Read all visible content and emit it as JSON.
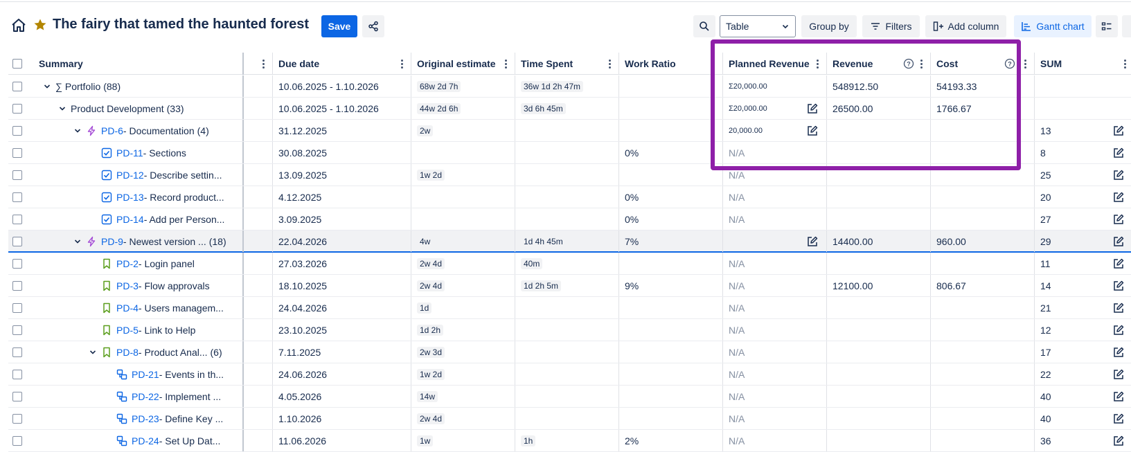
{
  "toolbar": {
    "title": "The fairy that tamed the haunted forest",
    "save_label": "Save",
    "view_select_value": "Table",
    "group_by_label": "Group by",
    "filters_label": "Filters",
    "add_column_label": "Add column",
    "gantt_label": "Gantt chart"
  },
  "columns": {
    "summary": "Summary",
    "due_date": "Due date",
    "original_estimate": "Original estimate",
    "time_spent": "Time Spent",
    "work_ratio": "Work Ratio",
    "planned_revenue": "Planned Revenue",
    "revenue": "Revenue",
    "cost": "Cost",
    "sum": "SUM"
  },
  "colors": {
    "accent": "#0c66e4",
    "highlight": "#8e1fa8",
    "epic": "#a54cd6",
    "task": "#0c66e4",
    "story": "#5b9e1d",
    "subtask": "#0c66e4"
  },
  "rows": [
    {
      "indent": 0,
      "chevron": true,
      "type": "sum",
      "key": "",
      "title": "∑ Portfolio",
      "count": "(88)",
      "due": "10.06.2025 - 1.10.2026",
      "estimate": "68w 2d 7h",
      "spent": "36w 1d 2h 47m",
      "ratio": "",
      "planned": "Σ20,000.00",
      "planned_edit": false,
      "revenue": "548912.50",
      "cost": "54193.33",
      "sum": "",
      "sum_edit": false
    },
    {
      "indent": 1,
      "chevron": true,
      "type": "none",
      "key": "",
      "title": "Product Development",
      "count": "(33)",
      "due": "10.06.2025 - 1.10.2026",
      "estimate": "44w 2d 6h",
      "spent": "3d 6h 45m",
      "ratio": "",
      "planned": "Σ20,000.00",
      "planned_edit": true,
      "revenue": "26500.00",
      "cost": "1766.67",
      "sum": "",
      "sum_edit": false
    },
    {
      "indent": 2,
      "chevron": true,
      "type": "epic",
      "key": "PD-6",
      "title": " - Documentation",
      "count": "(4)",
      "due": "31.12.2025",
      "estimate": "2w",
      "spent": "",
      "ratio": "",
      "planned": "20,000.00",
      "planned_edit": true,
      "revenue": "",
      "cost": "",
      "sum": "13",
      "sum_edit": true
    },
    {
      "indent": 3,
      "chevron": false,
      "type": "task",
      "key": "PD-11",
      "title": " - Sections",
      "count": "",
      "due": "30.08.2025",
      "estimate": "",
      "spent": "",
      "ratio": "0%",
      "planned": "N/A",
      "planned_edit": false,
      "revenue": "",
      "cost": "",
      "sum": "8",
      "sum_edit": true
    },
    {
      "indent": 3,
      "chevron": false,
      "type": "task",
      "key": "PD-12",
      "title": " - Describe settin...",
      "count": "",
      "due": "13.09.2025",
      "estimate": "1w 2d",
      "spent": "",
      "ratio": "",
      "planned": "N/A",
      "planned_edit": false,
      "revenue": "",
      "cost": "",
      "sum": "25",
      "sum_edit": true
    },
    {
      "indent": 3,
      "chevron": false,
      "type": "task",
      "key": "PD-13",
      "title": " - Record product...",
      "count": "",
      "due": "4.12.2025",
      "estimate": "",
      "spent": "",
      "ratio": "0%",
      "planned": "N/A",
      "planned_edit": false,
      "revenue": "",
      "cost": "",
      "sum": "20",
      "sum_edit": true
    },
    {
      "indent": 3,
      "chevron": false,
      "type": "task",
      "key": "PD-14",
      "title": " - Add per Person...",
      "count": "",
      "due": "3.09.2025",
      "estimate": "",
      "spent": "",
      "ratio": "0%",
      "planned": "N/A",
      "planned_edit": false,
      "revenue": "",
      "cost": "",
      "sum": "27",
      "sum_edit": true
    },
    {
      "indent": 2,
      "chevron": true,
      "type": "epic",
      "key": "PD-9",
      "title": " - Newest version ...",
      "count": "(18)",
      "due": "22.04.2026",
      "estimate": "4w",
      "spent": "1d 4h 45m",
      "ratio": "7%",
      "planned": "",
      "planned_edit": true,
      "revenue": "14400.00",
      "cost": "960.00",
      "sum": "29",
      "sum_edit": true,
      "highlight": true
    },
    {
      "indent": 3,
      "chevron": false,
      "type": "story",
      "key": "PD-2",
      "title": " - Login panel",
      "count": "",
      "due": "27.03.2026",
      "estimate": "2w 4d",
      "spent": "40m",
      "ratio": "",
      "planned": "N/A",
      "planned_edit": false,
      "revenue": "",
      "cost": "",
      "sum": "11",
      "sum_edit": true
    },
    {
      "indent": 3,
      "chevron": false,
      "type": "story",
      "key": "PD-3",
      "title": " - Flow approvals",
      "count": "",
      "due": "18.10.2025",
      "estimate": "2w 4d",
      "spent": "1d 2h 5m",
      "ratio": "9%",
      "planned": "N/A",
      "planned_edit": false,
      "revenue": "12100.00",
      "cost": "806.67",
      "sum": "14",
      "sum_edit": true
    },
    {
      "indent": 3,
      "chevron": false,
      "type": "story",
      "key": "PD-4",
      "title": " - Users managem...",
      "count": "",
      "due": "24.04.2026",
      "estimate": "1d",
      "spent": "",
      "ratio": "",
      "planned": "N/A",
      "planned_edit": false,
      "revenue": "",
      "cost": "",
      "sum": "21",
      "sum_edit": true
    },
    {
      "indent": 3,
      "chevron": false,
      "type": "story",
      "key": "PD-5",
      "title": " - Link to Help",
      "count": "",
      "due": "23.10.2025",
      "estimate": "1d 2h",
      "spent": "",
      "ratio": "",
      "planned": "N/A",
      "planned_edit": false,
      "revenue": "",
      "cost": "",
      "sum": "12",
      "sum_edit": true
    },
    {
      "indent": 3,
      "chevron": true,
      "type": "story",
      "key": "PD-8",
      "title": " - Product Anal...",
      "count": "(6)",
      "due": "7.11.2025",
      "estimate": "2w 3d",
      "spent": "",
      "ratio": "",
      "planned": "N/A",
      "planned_edit": false,
      "revenue": "",
      "cost": "",
      "sum": "17",
      "sum_edit": true
    },
    {
      "indent": 4,
      "chevron": false,
      "type": "subtask",
      "key": "PD-21",
      "title": " - Events in th...",
      "count": "",
      "due": "24.06.2026",
      "estimate": "1w 2d",
      "spent": "",
      "ratio": "",
      "planned": "N/A",
      "planned_edit": false,
      "revenue": "",
      "cost": "",
      "sum": "22",
      "sum_edit": true
    },
    {
      "indent": 4,
      "chevron": false,
      "type": "subtask",
      "key": "PD-22",
      "title": " - Implement ...",
      "count": "",
      "due": "4.05.2026",
      "estimate": "14w",
      "spent": "",
      "ratio": "",
      "planned": "N/A",
      "planned_edit": false,
      "revenue": "",
      "cost": "",
      "sum": "40",
      "sum_edit": true
    },
    {
      "indent": 4,
      "chevron": false,
      "type": "subtask",
      "key": "PD-23",
      "title": " - Define Key ...",
      "count": "",
      "due": "1.10.2026",
      "estimate": "2w 4d",
      "spent": "",
      "ratio": "",
      "planned": "N/A",
      "planned_edit": false,
      "revenue": "",
      "cost": "",
      "sum": "40",
      "sum_edit": true
    },
    {
      "indent": 4,
      "chevron": false,
      "type": "subtask",
      "key": "PD-24",
      "title": " - Set Up Dat...",
      "count": "",
      "due": "11.06.2026",
      "estimate": "1w",
      "spent": "1h",
      "ratio": "2%",
      "planned": "N/A",
      "planned_edit": false,
      "revenue": "",
      "cost": "",
      "sum": "36",
      "sum_edit": true
    }
  ]
}
